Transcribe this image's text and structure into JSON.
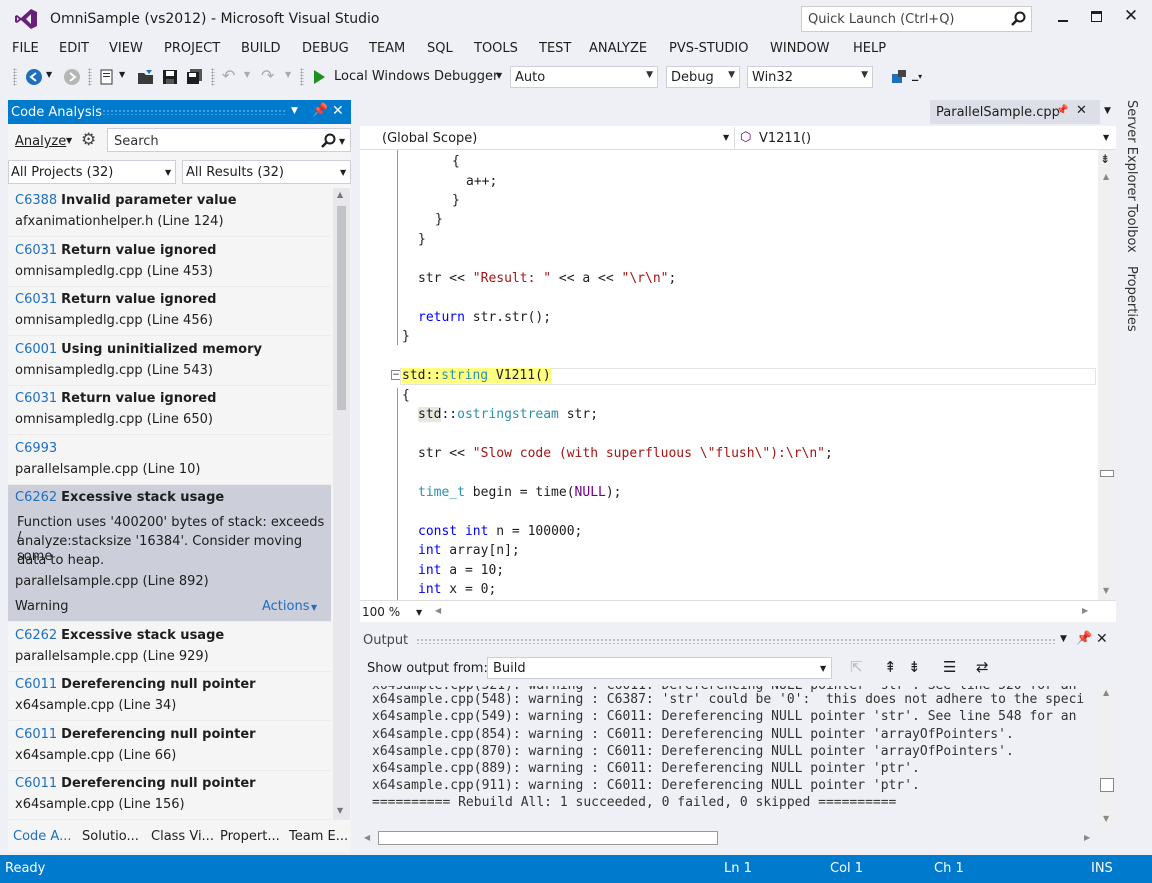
{
  "window": {
    "title": "OmniSample (vs2012) - Microsoft Visual Studio",
    "quick_launch_placeholder": "Quick Launch (Ctrl+Q)"
  },
  "menu": [
    "FILE",
    "EDIT",
    "VIEW",
    "PROJECT",
    "BUILD",
    "DEBUG",
    "TEAM",
    "SQL",
    "TOOLS",
    "TEST",
    "ANALYZE",
    "PVS-STUDIO",
    "WINDOW",
    "HELP"
  ],
  "toolbar": {
    "debugger": "Local Windows Debugger",
    "solution_config_mode": "Auto",
    "configuration": "Debug",
    "platform": "Win32"
  },
  "code_analysis": {
    "title": "Code Analysis",
    "analyze_label": "Analyze",
    "search_placeholder": "Search",
    "projects_filter": "All Projects (32)",
    "results_filter": "All Results (32)",
    "items": [
      {
        "code": "C6388",
        "title": "Invalid parameter value",
        "file": "afxanimationhelper.h (Line 124)"
      },
      {
        "code": "C6031",
        "title": "Return value ignored",
        "file": "omnisampledlg.cpp (Line 453)"
      },
      {
        "code": "C6031",
        "title": "Return value ignored",
        "file": "omnisampledlg.cpp (Line 456)"
      },
      {
        "code": "C6001",
        "title": "Using uninitialized memory",
        "file": "omnisampledlg.cpp (Line 543)"
      },
      {
        "code": "C6031",
        "title": "Return value ignored",
        "file": "omnisampledlg.cpp (Line 650)"
      },
      {
        "code": "C6993",
        "title": "",
        "file": "parallelsample.cpp (Line 10)"
      }
    ],
    "selected": {
      "code": "C6262",
      "title": "Excessive stack usage",
      "desc1": "Function uses '400200' bytes of stack:  exceeds /",
      "desc2": "analyze:stacksize '16384'.  Consider moving some",
      "desc3": "data to heap.",
      "file": "parallelsample.cpp (Line 892)",
      "severity": "Warning",
      "actions": "Actions"
    },
    "items2": [
      {
        "code": "C6262",
        "title": "Excessive stack usage",
        "file": "parallelsample.cpp (Line 929)"
      },
      {
        "code": "C6011",
        "title": "Dereferencing null pointer",
        "file": "x64sample.cpp (Line 34)"
      },
      {
        "code": "C6011",
        "title": "Dereferencing null pointer",
        "file": "x64sample.cpp (Line 66)"
      },
      {
        "code": "C6011",
        "title": "Dereferencing null pointer",
        "file": "x64sample.cpp (Line 156)"
      }
    ],
    "bottom_tabs": [
      "Code A...",
      "Solutio...",
      "Class Vi...",
      "Propert...",
      "Team E..."
    ]
  },
  "editor": {
    "tab": "ParallelSample.cpp",
    "scope": "(Global Scope)",
    "member": "V1211()",
    "zoom": "100 %"
  },
  "side_tabs": [
    "Server Explorer",
    "Toolbox",
    "Properties"
  ],
  "output": {
    "title": "Output",
    "show_from_label": "Show output from:",
    "source": "Build",
    "lines": [
      "x64sample.cpp(548): warning : C6387: 'str' could be '0':  this does not adhere to the speci",
      "x64sample.cpp(549): warning : C6011: Dereferencing NULL pointer 'str'. See line 548 for an",
      "x64sample.cpp(854): warning : C6011: Dereferencing NULL pointer 'arrayOfPointers'.",
      "x64sample.cpp(870): warning : C6011: Dereferencing NULL pointer 'arrayOfPointers'.",
      "x64sample.cpp(889): warning : C6011: Dereferencing NULL pointer 'ptr'.",
      "x64sample.cpp(911): warning : C6011: Dereferencing NULL pointer 'ptr'.",
      "========== Rebuild All: 1 succeeded, 0 failed, 0 skipped =========="
    ]
  },
  "status": {
    "state": "Ready",
    "ln": "Ln 1",
    "col": "Col 1",
    "ch": "Ch 1",
    "mode": "INS"
  }
}
